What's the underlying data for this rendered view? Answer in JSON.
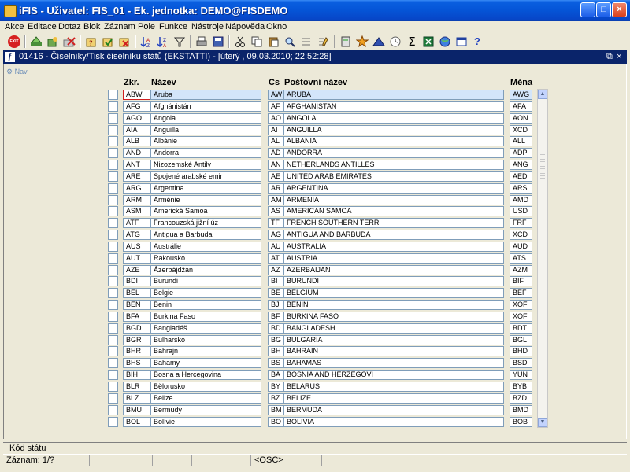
{
  "window": {
    "title": "iFIS - Uživatel: FIS_01 - Ek. jednotka: DEMO@FISDEMO",
    "minimize": "_",
    "maximize": "□",
    "close": "×"
  },
  "menu": [
    "Akce",
    "Editace",
    "Dotaz",
    "Blok",
    "Záznam",
    "Pole",
    "Funkce",
    "Nástroje",
    "Nápověda",
    "Okno"
  ],
  "toolbar": {
    "exit_label": "EXIT",
    "sum_glyph": "Σ",
    "help_glyph": "?"
  },
  "form": {
    "title": "01416 - Číselníky/Tisk číselníku států (EKSTATTI) - [úterý , 09.03.2010; 22:52:28]",
    "icon_letter": "f",
    "restore_glyph": "⧉",
    "close_glyph": "×",
    "nav_label": "Nav"
  },
  "columns": {
    "zkr": "Zkr.",
    "nazev": "Název",
    "cs": "Cs",
    "postovni": "Poštovní název",
    "mena": "Měna"
  },
  "rows": [
    {
      "zkr": "ABW",
      "nazev": "Aruba",
      "cs": "AW",
      "postovni": "ARUBA",
      "mena": "AWG"
    },
    {
      "zkr": "AFG",
      "nazev": "Afghánistán",
      "cs": "AF",
      "postovni": "AFGHANISTAN",
      "mena": "AFA"
    },
    {
      "zkr": "AGO",
      "nazev": "Angola",
      "cs": "AO",
      "postovni": "ANGOLA",
      "mena": "AON"
    },
    {
      "zkr": "AIA",
      "nazev": "Anguilla",
      "cs": "AI",
      "postovni": "ANGUILLA",
      "mena": "XCD"
    },
    {
      "zkr": "ALB",
      "nazev": "Albánie",
      "cs": "AL",
      "postovni": "ALBANIA",
      "mena": "ALL"
    },
    {
      "zkr": "AND",
      "nazev": "Andorra",
      "cs": "AD",
      "postovni": "ANDORRA",
      "mena": "ADP"
    },
    {
      "zkr": "ANT",
      "nazev": "Nizozemské Antily",
      "cs": "AN",
      "postovni": "NETHERLANDS ANTILLES",
      "mena": "ANG"
    },
    {
      "zkr": "ARE",
      "nazev": "Spojené arabské emir",
      "cs": "AE",
      "postovni": "UNITED ARAB EMIRATES",
      "mena": "AED"
    },
    {
      "zkr": "ARG",
      "nazev": "Argentina",
      "cs": "AR",
      "postovni": "ARGENTINA",
      "mena": "ARS"
    },
    {
      "zkr": "ARM",
      "nazev": "Arménie",
      "cs": "AM",
      "postovni": "ARMENIA",
      "mena": "AMD"
    },
    {
      "zkr": "ASM",
      "nazev": "Americká Samoa",
      "cs": "AS",
      "postovni": "AMERICAN SAMOA",
      "mena": "USD"
    },
    {
      "zkr": "ATF",
      "nazev": "Francouzská jižní úz",
      "cs": "TF",
      "postovni": "FRENCH SOUTHERN TERR",
      "mena": "FRF"
    },
    {
      "zkr": "ATG",
      "nazev": "Antigua a Barbuda",
      "cs": "AG",
      "postovni": "ANTIGUA AND BARBUDA",
      "mena": "XCD"
    },
    {
      "zkr": "AUS",
      "nazev": "Austrálie",
      "cs": "AU",
      "postovni": "AUSTRALIA",
      "mena": "AUD"
    },
    {
      "zkr": "AUT",
      "nazev": "Rakousko",
      "cs": "AT",
      "postovni": "AUSTRIA",
      "mena": "ATS"
    },
    {
      "zkr": "AZE",
      "nazev": "Ázerbájdžán",
      "cs": "AZ",
      "postovni": "AZERBAIJAN",
      "mena": "AZM"
    },
    {
      "zkr": "BDI",
      "nazev": "Burundi",
      "cs": "BI",
      "postovni": "BURUNDI",
      "mena": "BIF"
    },
    {
      "zkr": "BEL",
      "nazev": "Belgie",
      "cs": "BE",
      "postovni": "BELGIUM",
      "mena": "BEF"
    },
    {
      "zkr": "BEN",
      "nazev": "Benin",
      "cs": "BJ",
      "postovni": "BENIN",
      "mena": "XOF"
    },
    {
      "zkr": "BFA",
      "nazev": "Burkina Faso",
      "cs": "BF",
      "postovni": "BURKINA FASO",
      "mena": "XOF"
    },
    {
      "zkr": "BGD",
      "nazev": "Bangladéš",
      "cs": "BD",
      "postovni": "BANGLADESH",
      "mena": "BDT"
    },
    {
      "zkr": "BGR",
      "nazev": "Bulharsko",
      "cs": "BG",
      "postovni": "BULGARIA",
      "mena": "BGL"
    },
    {
      "zkr": "BHR",
      "nazev": "Bahrajn",
      "cs": "BH",
      "postovni": "BAHRAIN",
      "mena": "BHD"
    },
    {
      "zkr": "BHS",
      "nazev": "Bahamy",
      "cs": "BS",
      "postovni": "BAHAMAS",
      "mena": "BSD"
    },
    {
      "zkr": "BIH",
      "nazev": "Bosna a Hercegovina",
      "cs": "BA",
      "postovni": "BOSNIA AND HERZEGOVI",
      "mena": "YUN"
    },
    {
      "zkr": "BLR",
      "nazev": "Bělorusko",
      "cs": "BY",
      "postovni": "BELARUS",
      "mena": "BYB"
    },
    {
      "zkr": "BLZ",
      "nazev": "Belize",
      "cs": "BZ",
      "postovni": "BELIZE",
      "mena": "BZD"
    },
    {
      "zkr": "BMU",
      "nazev": "Bermudy",
      "cs": "BM",
      "postovni": "BERMUDA",
      "mena": "BMD"
    },
    {
      "zkr": "BOL",
      "nazev": "Bolívie",
      "cs": "BO",
      "postovni": "BOLIVIA",
      "mena": "BOB"
    }
  ],
  "status": {
    "hint": "Kód státu",
    "record": "Záznam: 1/?",
    "mode": "<OSC>"
  },
  "colors": {
    "title_bar": "#0554d6",
    "inner_title": "#0a246a",
    "current_row": "#d3e5fa",
    "field_border": "#7f9db9"
  }
}
